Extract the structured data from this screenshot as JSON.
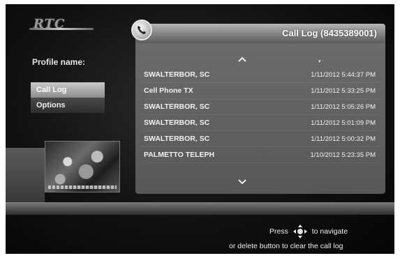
{
  "app": {
    "logo_text": "RTC"
  },
  "sidebar": {
    "profile_label": "Profile name:",
    "menu": [
      {
        "label": "Call Log",
        "active": true
      },
      {
        "label": "Options",
        "active": false
      }
    ]
  },
  "call_log": {
    "title": "Call Log (8435389001)",
    "sort_indicator": "▾",
    "rows": [
      {
        "name": "SWALTERBOR, SC",
        "time": "1/11/2012 5:44:37 PM"
      },
      {
        "name": "Cell Phone   TX",
        "time": "1/11/2012 5:33:25 PM"
      },
      {
        "name": "SWALTERBOR, SC",
        "time": "1/11/2012 5:05:26 PM"
      },
      {
        "name": "SWALTERBOR, SC",
        "time": "1/11/2012 5:01:09 PM"
      },
      {
        "name": "SWALTERBOR, SC",
        "time": "1/11/2012 5:00:32 PM"
      },
      {
        "name": "PALMETTO TELEPH",
        "time": "1/10/2012 5:23:35 PM"
      }
    ]
  },
  "footer": {
    "press_label": "Press",
    "navigate_label": "to navigate",
    "hint_line2": "or delete button to clear the call log"
  },
  "colors": {
    "background": "#111111",
    "panel": "#616161",
    "text": "#f2f2f2"
  }
}
